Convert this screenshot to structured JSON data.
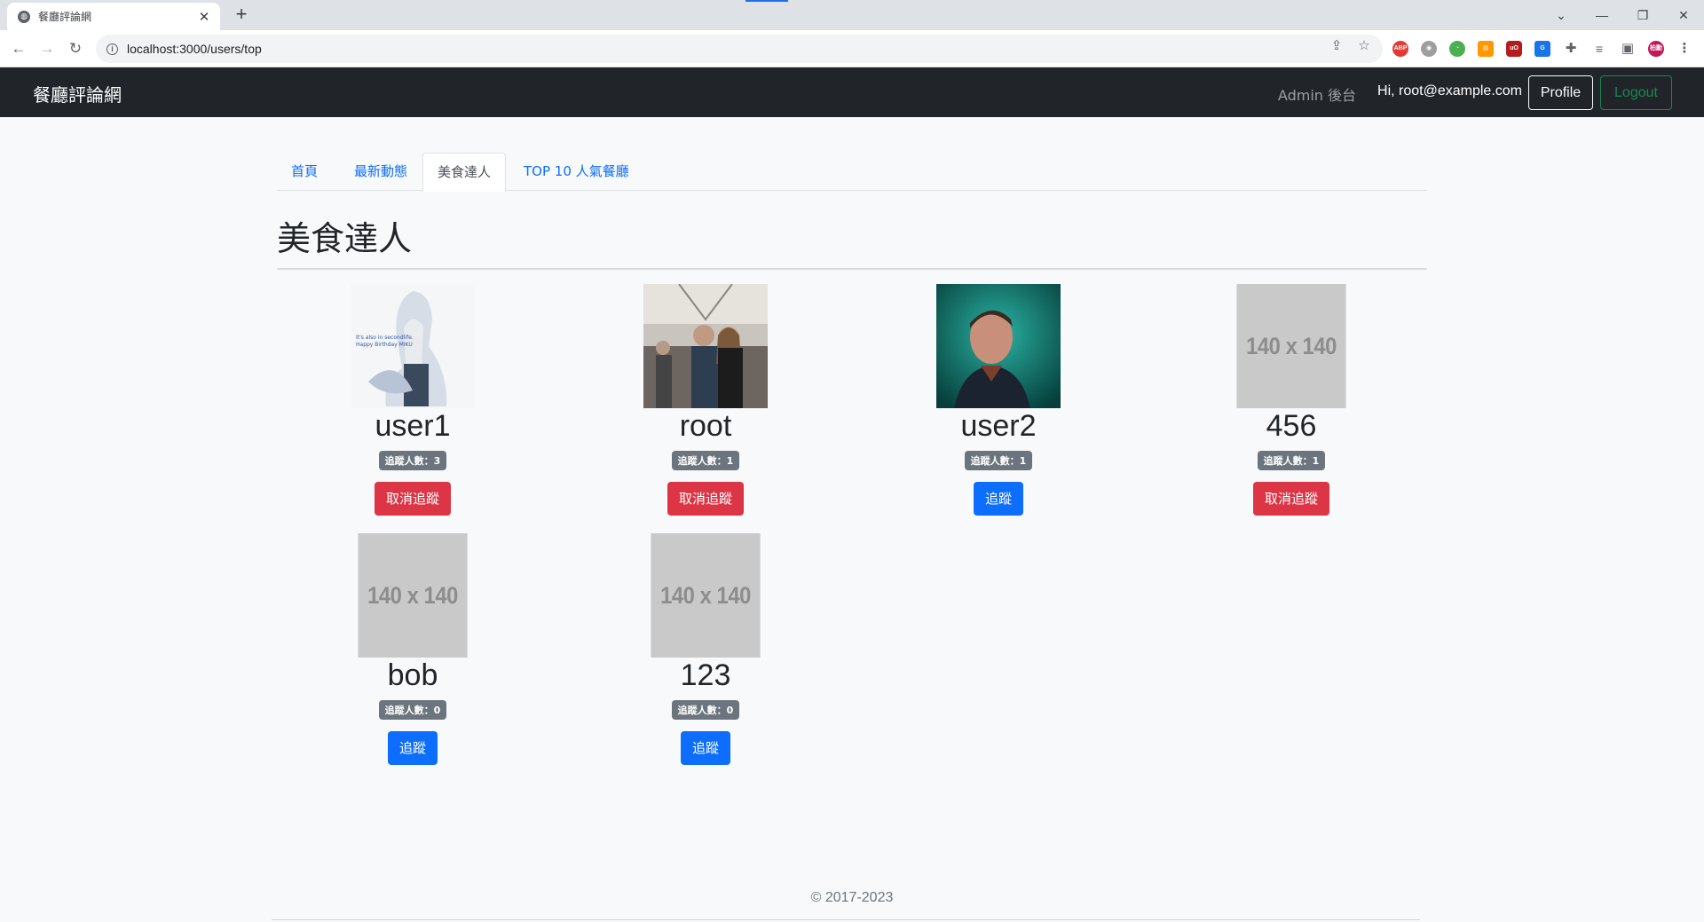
{
  "browser": {
    "tab_title": "餐廳評論網",
    "url": "localhost:3000/users/top"
  },
  "navbar": {
    "brand": "餐廳評論網",
    "admin_link": "Admin 後台",
    "greeting": "Hi, root@example.com",
    "profile_label": "Profile",
    "logout_label": "Logout"
  },
  "tabs": [
    {
      "label": "首頁",
      "active": false
    },
    {
      "label": "最新動態",
      "active": false
    },
    {
      "label": "美食達人",
      "active": true
    },
    {
      "label": "TOP 10 人氣餐廳",
      "active": false
    }
  ],
  "page_title": "美食達人",
  "users": [
    {
      "name": "user1",
      "followers": "追蹤人數：3",
      "button": "取消追蹤",
      "button_type": "danger",
      "avatar": "anime-girl-image"
    },
    {
      "name": "root",
      "followers": "追蹤人數：1",
      "button": "取消追蹤",
      "button_type": "danger",
      "avatar": "couple-photo"
    },
    {
      "name": "user2",
      "followers": "追蹤人數：1",
      "button": "追蹤",
      "button_type": "primary",
      "avatar": "man-portrait-photo"
    },
    {
      "name": "456",
      "followers": "追蹤人數：1",
      "button": "取消追蹤",
      "button_type": "danger",
      "avatar": "placeholder",
      "placeholder_text": "140 x 140"
    },
    {
      "name": "bob",
      "followers": "追蹤人數：0",
      "button": "追蹤",
      "button_type": "primary",
      "avatar": "placeholder",
      "placeholder_text": "140 x 140"
    },
    {
      "name": "123",
      "followers": "追蹤人數：0",
      "button": "追蹤",
      "button_type": "primary",
      "avatar": "placeholder",
      "placeholder_text": "140 x 140"
    }
  ],
  "footer": "© 2017-2023",
  "colors": {
    "navbar_bg": "#212529",
    "link": "#0d6efd",
    "danger": "#dc3545",
    "success": "#198754",
    "badge": "#6c757d"
  }
}
